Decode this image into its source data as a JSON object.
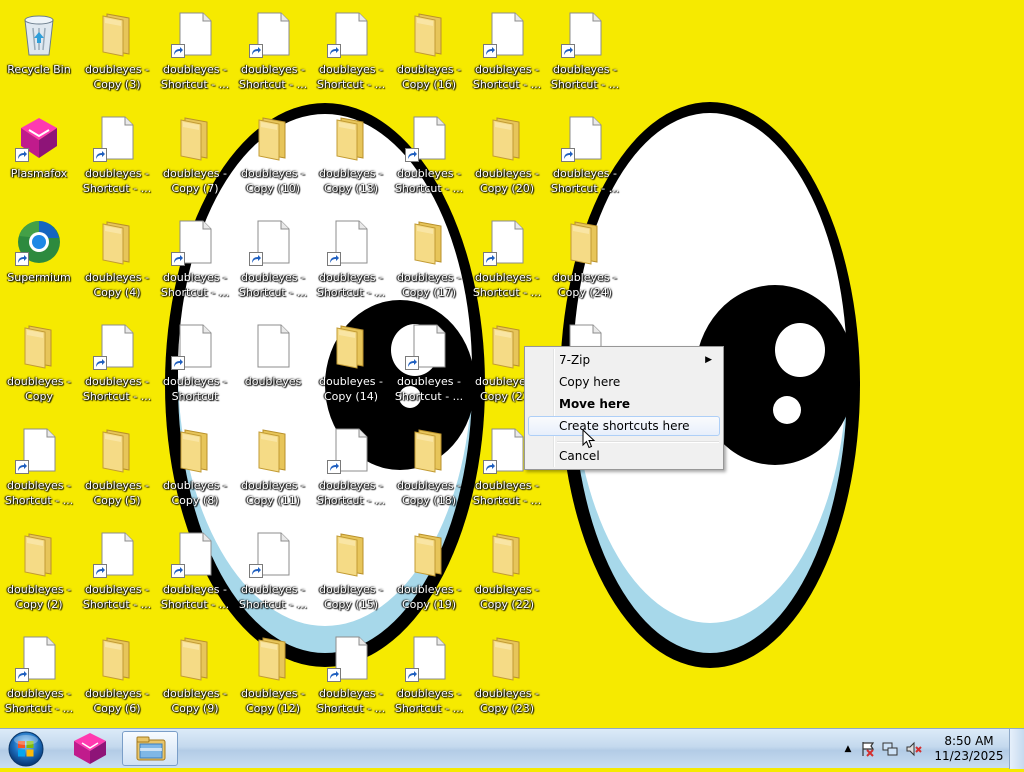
{
  "desktop": {
    "icons": [
      {
        "label": "Recycle Bin",
        "type": "bin",
        "col": 0,
        "row": 0
      },
      {
        "label": "doubleyes -\nCopy (3)",
        "type": "folder",
        "col": 1,
        "row": 0
      },
      {
        "label": "doubleyes -\nShortcut - ...",
        "type": "shortcut",
        "col": 2,
        "row": 0
      },
      {
        "label": "doubleyes -\nShortcut - ...",
        "type": "shortcut",
        "col": 3,
        "row": 0
      },
      {
        "label": "doubleyes -\nShortcut - ...",
        "type": "shortcut",
        "col": 4,
        "row": 0
      },
      {
        "label": "doubleyes -\nCopy (16)",
        "type": "folder",
        "col": 5,
        "row": 0
      },
      {
        "label": "doubleyes -\nShortcut - ...",
        "type": "shortcut",
        "col": 6,
        "row": 0
      },
      {
        "label": "doubleyes -\nShortcut - ...",
        "type": "shortcut",
        "col": 7,
        "row": 0
      },
      {
        "label": "Plasmafox",
        "type": "plasmafox",
        "col": 0,
        "row": 1
      },
      {
        "label": "doubleyes -\nShortcut - ...",
        "type": "shortcut",
        "col": 1,
        "row": 1
      },
      {
        "label": "doubleyes -\nCopy (7)",
        "type": "folder",
        "col": 2,
        "row": 1
      },
      {
        "label": "doubleyes -\nCopy (10)",
        "type": "folder",
        "col": 3,
        "row": 1
      },
      {
        "label": "doubleyes -\nCopy (13)",
        "type": "folder",
        "col": 4,
        "row": 1
      },
      {
        "label": "doubleyes -\nShortcut - ...",
        "type": "shortcut",
        "col": 5,
        "row": 1
      },
      {
        "label": "doubleyes -\nCopy (20)",
        "type": "folder",
        "col": 6,
        "row": 1
      },
      {
        "label": "doubleyes -\nShortcut - ...",
        "type": "shortcut",
        "col": 7,
        "row": 1
      },
      {
        "label": "Supermium",
        "type": "supermium",
        "col": 0,
        "row": 2
      },
      {
        "label": "doubleyes -\nCopy (4)",
        "type": "folder",
        "col": 1,
        "row": 2
      },
      {
        "label": "doubleyes -\nShortcut - ...",
        "type": "shortcut",
        "col": 2,
        "row": 2
      },
      {
        "label": "doubleyes -\nShortcut - ...",
        "type": "shortcut",
        "col": 3,
        "row": 2
      },
      {
        "label": "doubleyes -\nShortcut - ...",
        "type": "shortcut",
        "col": 4,
        "row": 2
      },
      {
        "label": "doubleyes -\nCopy (17)",
        "type": "folder",
        "col": 5,
        "row": 2
      },
      {
        "label": "doubleyes -\nShortcut - ...",
        "type": "shortcut",
        "col": 6,
        "row": 2
      },
      {
        "label": "doubleyes -\nCopy (24)",
        "type": "folder",
        "col": 7,
        "row": 2
      },
      {
        "label": "doubleyes -\nCopy",
        "type": "folder",
        "col": 0,
        "row": 3
      },
      {
        "label": "doubleyes -\nShortcut - ...",
        "type": "shortcut",
        "col": 1,
        "row": 3
      },
      {
        "label": "doubleyes -\nShortcut",
        "type": "shortcut",
        "col": 2,
        "row": 3
      },
      {
        "label": "doubleyes",
        "type": "file",
        "col": 3,
        "row": 3
      },
      {
        "label": "doubleyes -\nCopy (14)",
        "type": "folder",
        "col": 4,
        "row": 3
      },
      {
        "label": "doubleyes -\nShortcut - ...",
        "type": "shortcut",
        "col": 5,
        "row": 3
      },
      {
        "label": "doubleyes -\nCopy (21)",
        "type": "folder",
        "col": 6,
        "row": 3
      },
      {
        "label": "doubleyes -\nShortcut - ...",
        "type": "shortcut",
        "col": 7,
        "row": 3
      },
      {
        "label": "doubleyes -\nShortcut - ...",
        "type": "shortcut",
        "col": 0,
        "row": 4
      },
      {
        "label": "doubleyes -\nCopy (5)",
        "type": "folder",
        "col": 1,
        "row": 4
      },
      {
        "label": "doubleyes -\nCopy (8)",
        "type": "folder",
        "col": 2,
        "row": 4
      },
      {
        "label": "doubleyes -\nCopy (11)",
        "type": "folder",
        "col": 3,
        "row": 4
      },
      {
        "label": "doubleyes -\nShortcut - ...",
        "type": "shortcut",
        "col": 4,
        "row": 4
      },
      {
        "label": "doubleyes -\nCopy (18)",
        "type": "folder",
        "col": 5,
        "row": 4
      },
      {
        "label": "doubleyes -\nShortcut - ...",
        "type": "shortcut",
        "col": 6,
        "row": 4
      },
      {
        "label": "doubleyes -\nCopy (2)",
        "type": "folder",
        "col": 0,
        "row": 5
      },
      {
        "label": "doubleyes -\nShortcut - ...",
        "type": "shortcut",
        "col": 1,
        "row": 5
      },
      {
        "label": "doubleyes -\nShortcut - ...",
        "type": "shortcut",
        "col": 2,
        "row": 5
      },
      {
        "label": "doubleyes -\nShortcut - ...",
        "type": "shortcut",
        "col": 3,
        "row": 5
      },
      {
        "label": "doubleyes -\nCopy (15)",
        "type": "folder",
        "col": 4,
        "row": 5
      },
      {
        "label": "doubleyes -\nCopy (19)",
        "type": "folder",
        "col": 5,
        "row": 5
      },
      {
        "label": "doubleyes -\nCopy (22)",
        "type": "folder",
        "col": 6,
        "row": 5
      },
      {
        "label": "doubleyes -\nShortcut - ...",
        "type": "shortcut",
        "col": 0,
        "row": 6
      },
      {
        "label": "doubleyes -\nCopy (6)",
        "type": "folder",
        "col": 1,
        "row": 6
      },
      {
        "label": "doubleyes -\nCopy (9)",
        "type": "folder",
        "col": 2,
        "row": 6
      },
      {
        "label": "doubleyes -\nCopy (12)",
        "type": "folder",
        "col": 3,
        "row": 6
      },
      {
        "label": "doubleyes -\nShortcut - ...",
        "type": "shortcut",
        "col": 4,
        "row": 6
      },
      {
        "label": "doubleyes -\nShortcut - ...",
        "type": "shortcut",
        "col": 5,
        "row": 6
      },
      {
        "label": "doubleyes -\nCopy (23)",
        "type": "folder",
        "col": 6,
        "row": 6
      }
    ]
  },
  "context_menu": {
    "items": [
      {
        "label": "7-Zip",
        "submenu": true,
        "bold": false,
        "hover": false
      },
      {
        "label": "Copy here",
        "submenu": false,
        "bold": false,
        "hover": false
      },
      {
        "label": "Move here",
        "submenu": false,
        "bold": true,
        "hover": false
      },
      {
        "label": "Create shortcuts here",
        "submenu": false,
        "bold": false,
        "hover": true
      },
      {
        "label": "Cancel",
        "submenu": false,
        "bold": false,
        "hover": false
      }
    ],
    "submenu_glyph": "▶"
  },
  "taskbar": {
    "pinned": [
      {
        "name": "plasmafox-taskbar-button",
        "active": false
      },
      {
        "name": "explorer-taskbar-button",
        "active": true
      }
    ],
    "tray": {
      "show_hidden_glyph": "▲",
      "icons": [
        "action-center-icon",
        "network-icon",
        "volume-muted-icon"
      ]
    },
    "clock": {
      "time": "8:50 AM",
      "date": "11/23/2025"
    }
  },
  "colors": {
    "wallpaper": "#f6ea00",
    "folder": "#f2d46b",
    "menu_hover_border": "#aecff7"
  }
}
